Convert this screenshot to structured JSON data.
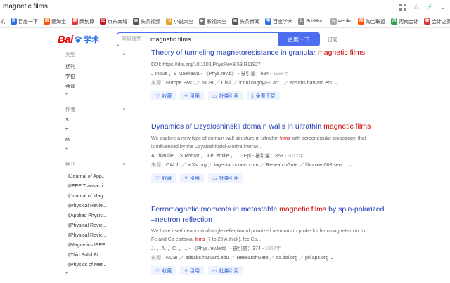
{
  "browser": {
    "tab_title": "magnetic films",
    "bookmarks": [
      {
        "label": "机",
        "color": "#ffffff",
        "fg": "#333333",
        "glyph": ""
      },
      {
        "label": "百度一下",
        "color": "#2f6fe4",
        "glyph": "百"
      },
      {
        "label": "爱淘宝",
        "color": "#ff5000",
        "glyph": "淘"
      },
      {
        "label": "聚划算",
        "color": "#e4393c",
        "glyph": "聚"
      },
      {
        "label": "京东商城",
        "color": "#c91623",
        "glyph": "JD"
      },
      {
        "label": "头条视频",
        "color": "#555555",
        "glyph": "▦"
      },
      {
        "label": "小说大全",
        "color": "#e2a128",
        "glyph": "书"
      },
      {
        "label": "影视大全",
        "color": "#777777",
        "glyph": "▶"
      },
      {
        "label": "头条新闻",
        "color": "#555555",
        "glyph": "▦"
      },
      {
        "label": "百度学术",
        "color": "#2f6fe4",
        "glyph": "学"
      },
      {
        "label": "Sci-Hub:",
        "color": "#888888",
        "glyph": "S"
      },
      {
        "label": "wenku",
        "color": "#aaaaaa",
        "glyph": "w"
      },
      {
        "label": "淘宝联盟",
        "color": "#ff5000",
        "glyph": "淘"
      },
      {
        "label": "河南会计",
        "color": "#2aa14a",
        "glyph": "河"
      },
      {
        "label": "会计之家",
        "color": "#d33",
        "glyph": "会"
      }
    ]
  },
  "header": {
    "logo_bai": "Bai",
    "logo_du": "du",
    "logo_xueshu": "学术",
    "advanced_search": "高级搜索",
    "query": "magnetic films",
    "search_button": "百度一下",
    "subscribe": "订阅"
  },
  "sidebar": {
    "type_heading": "类型",
    "type_items": [
      "期刊",
      "学位",
      "会议"
    ],
    "plus1": "+",
    "author_heading": "作者",
    "author_items": [
      "S.",
      "T.",
      "M."
    ],
    "plus2": "+",
    "journal_heading": "期刊",
    "journal_items": [
      "《Journal of App...",
      "《IEEE Transacti...",
      "《Journal of Mag...",
      "《Physical Revie...",
      "《Applied Physic...",
      "《Physical Revie...",
      "《Physical Revie...",
      "《Magnetics IEEE...",
      "《Thin Solid Fil...",
      "《Physics of Met..."
    ],
    "plus3": "+"
  },
  "results": [
    {
      "title_pre": "Theory of tunneling magnetoresistance in granular ",
      "title_hl": "magnetic films",
      "title_post": "",
      "line1": "DOI: https://doi.org/10.1103/PhysRevB.53.R11927",
      "line1_pre": "",
      "line1_hl": "",
      "line1_post": "",
      "line2": "",
      "meta": "J Inoue ，S Maekawa - 《Phys.rev.b》 - 被引量：684 - ",
      "year": "1996年",
      "source_label": "来源：",
      "source": "Europe PMC ／ NCBI ／ CiNii ／ ir.nul.nagoya-u.ac... ／ adsabs.harvard.edu",
      "actions": [
        "收藏",
        "引用",
        "批量引用",
        "免费下载"
      ]
    },
    {
      "title_pre": "Dynamics of Dzyaloshinskii domain walls in ultrathin ",
      "title_hl": "magnetic films",
      "title_post": "",
      "line1": "",
      "line1_pre": "We explore a new type of domain wall structure in ultrathin ",
      "line1_hl": "films",
      "line1_post": " with perpendicular anisotropy, that",
      "line2": "is influenced by the Dzyaloshinskii-Moriya interac...",
      "meta": "A Thiaville ，S Rohart ，Jué, émilie ，... - Epl - 被引量：359 - ",
      "year": "2012年",
      "source_label": "来源：",
      "source": "OALib ／ arXiv.org ／ ingentaconnect.com ／ ResearchGate ／ lib-arxiv-008.serv...",
      "actions": [
        "收藏",
        "引用",
        "批量引用"
      ]
    },
    {
      "title_pre": "Ferromagnetic moments in metastable ",
      "title_hl": "magnetic films",
      "title_post": " by spin-polarized",
      "title_line2": "–neutron reflection",
      "line1": "We have used near-critical-angle reflection of polarized neutrons to probe for ferromagnetism in fcc",
      "line1_pre": "",
      "line1_hl": "",
      "line1_post": "",
      "line2_pre": "Fe and Co epitaxial ",
      "line2_hl": "films",
      "line2_post": " (7 to 20 A thick). fcc Co...",
      "meta": "J. ，A. ，C. ，... - 《Phys.rev.lett》 - 被引量：374 - ",
      "year": "1967年",
      "source_label": "来源：",
      "source": "NCBI ／ adsabs.harvard.edu ／ ResearchGate ／ dx.doi.org ／ prl.aps.org",
      "actions": [
        "收藏",
        "引用",
        "批量引用"
      ]
    }
  ]
}
